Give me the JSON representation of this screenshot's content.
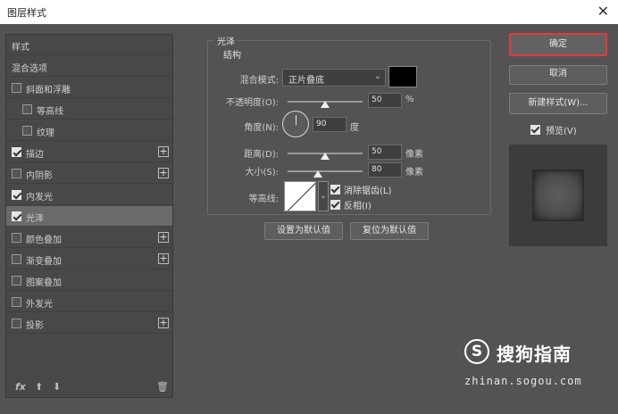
{
  "window": {
    "title": "图层样式",
    "close_icon": "close-icon"
  },
  "styles_list": {
    "items": [
      {
        "label": "样式",
        "has_checkbox": false,
        "checked": false,
        "has_plus": false,
        "selected": false
      },
      {
        "label": "混合选项",
        "has_checkbox": false,
        "checked": false,
        "has_plus": false,
        "selected": false
      },
      {
        "label": "斜面和浮雕",
        "has_checkbox": true,
        "checked": false,
        "has_plus": false,
        "selected": false
      },
      {
        "label": "等高线",
        "has_checkbox": true,
        "checked": false,
        "has_plus": false,
        "selected": false,
        "indent": true
      },
      {
        "label": "纹理",
        "has_checkbox": true,
        "checked": false,
        "has_plus": false,
        "selected": false,
        "indent": true
      },
      {
        "label": "描边",
        "has_checkbox": true,
        "checked": true,
        "has_plus": true,
        "selected": false
      },
      {
        "label": "内阴影",
        "has_checkbox": true,
        "checked": false,
        "has_plus": true,
        "selected": false
      },
      {
        "label": "内发光",
        "has_checkbox": true,
        "checked": true,
        "has_plus": false,
        "selected": false
      },
      {
        "label": "光泽",
        "has_checkbox": true,
        "checked": true,
        "has_plus": false,
        "selected": true
      },
      {
        "label": "颜色叠加",
        "has_checkbox": true,
        "checked": false,
        "has_plus": true,
        "selected": false
      },
      {
        "label": "渐变叠加",
        "has_checkbox": true,
        "checked": false,
        "has_plus": true,
        "selected": false
      },
      {
        "label": "图案叠加",
        "has_checkbox": true,
        "checked": false,
        "has_plus": false,
        "selected": false
      },
      {
        "label": "外发光",
        "has_checkbox": true,
        "checked": false,
        "has_plus": false,
        "selected": false
      },
      {
        "label": "投影",
        "has_checkbox": true,
        "checked": false,
        "has_plus": true,
        "selected": false
      }
    ],
    "fx_label": "fx",
    "up_icon": "arrow-up-icon",
    "down_icon": "arrow-down-icon",
    "trash_icon": "trash-icon"
  },
  "satin": {
    "section_title": "光泽",
    "group_title": "结构",
    "blend_mode_label": "混合模式:",
    "blend_mode_value": "正片叠底",
    "color": "#000000",
    "opacity_label": "不透明度(O):",
    "opacity_value": "50",
    "opacity_unit": "%",
    "opacity_fraction": 0.5,
    "angle_label": "角度(N):",
    "angle_value": "90",
    "angle_unit": "度",
    "distance_label": "距离(D):",
    "distance_value": "50",
    "distance_unit": "像素",
    "distance_fraction": 0.5,
    "size_label": "大小(S):",
    "size_value": "80",
    "size_unit": "像素",
    "size_fraction": 0.4,
    "contour_label": "等高线:",
    "antialias_label": "消除锯齿(L)",
    "antialias_checked": true,
    "invert_label": "反相(I)",
    "invert_checked": true,
    "set_default_label": "设置为默认值",
    "reset_default_label": "复位为默认值"
  },
  "actions": {
    "ok_label": "确定",
    "cancel_label": "取消",
    "new_style_label": "新建样式(W)...",
    "preview_label": "预览(V)",
    "preview_checked": true,
    "accent_color": "#e53a3a"
  },
  "watermark": {
    "logo_letter": "S",
    "text": "搜狗指南",
    "url": "zhinan.sogou.com"
  }
}
